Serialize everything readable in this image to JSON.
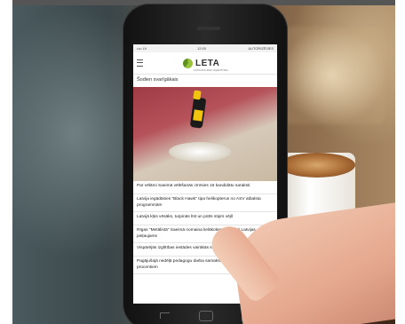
{
  "screen": {
    "statusbar": {
      "time": "12:00",
      "signal": "•••• LV",
      "right": "AUTORIZĒJIES"
    },
    "brand": {
      "name": "LETA",
      "tagline": "LATVIJAS ZIŅU AĢENTŪRA"
    },
    "section_title": "Šodien svarīgākais",
    "news": [
      "Par vēlāmi Saeimā vēlēšanās cīnīsies 16 kandidātu saraksti",
      "Latvija iegādāsies \"Black Hawk\" tipa helikopterus no ASV atbalsta programmām",
      "Latvijā kļūs vēsāks, turpinās līst un pūtīs stiprs vējš",
      "Rīgas \"Metālistā\" Saeimā nomaina lielākoties tiek sākti Latvijas pieļaujams",
      "Vispārējās izglītības iestādes vairākās skolās ir atrastas...",
      "Pagājušajā nedēļā pedagogu darba samaksa pieaugusi par 10 procentiem"
    ]
  },
  "colors": {
    "logo_green": "#9ac33c",
    "hero_red": "#9e3b44"
  }
}
